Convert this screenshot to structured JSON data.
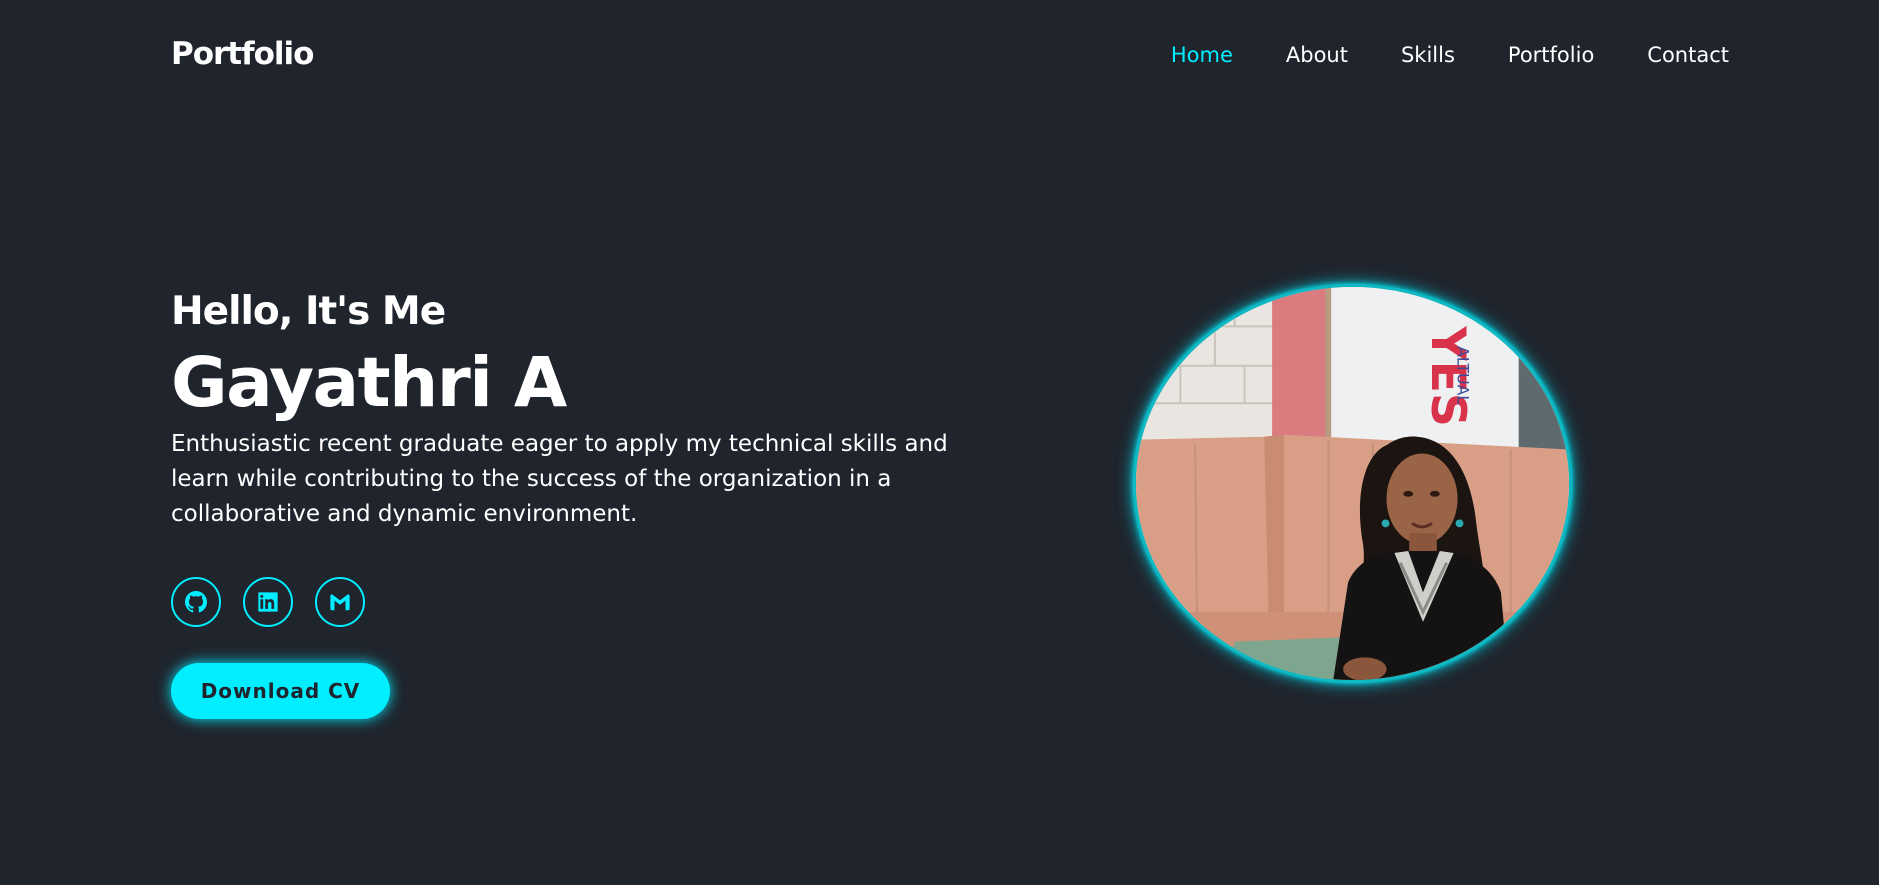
{
  "header": {
    "logo": "Portfolio",
    "nav": [
      {
        "label": "Home",
        "active": true
      },
      {
        "label": "About",
        "active": false
      },
      {
        "label": "Skills",
        "active": false
      },
      {
        "label": "Portfolio",
        "active": false
      },
      {
        "label": "Contact",
        "active": false
      }
    ]
  },
  "hero": {
    "greeting": "Hello, It's Me",
    "name": "Gayathri A",
    "description": "Enthusiastic recent graduate eager to apply my technical skills and learn while contributing to the success of the organization in a collaborative and dynamic environment.",
    "socials": [
      {
        "icon": "github-icon"
      },
      {
        "icon": "linkedin-icon"
      },
      {
        "icon": "gmail-icon"
      }
    ],
    "cv_button": "Download CV",
    "photo": {
      "icon": "profile-photo"
    }
  },
  "colors": {
    "background": "#1f242d",
    "accent": "#00eeff",
    "text": "#ffffff"
  }
}
